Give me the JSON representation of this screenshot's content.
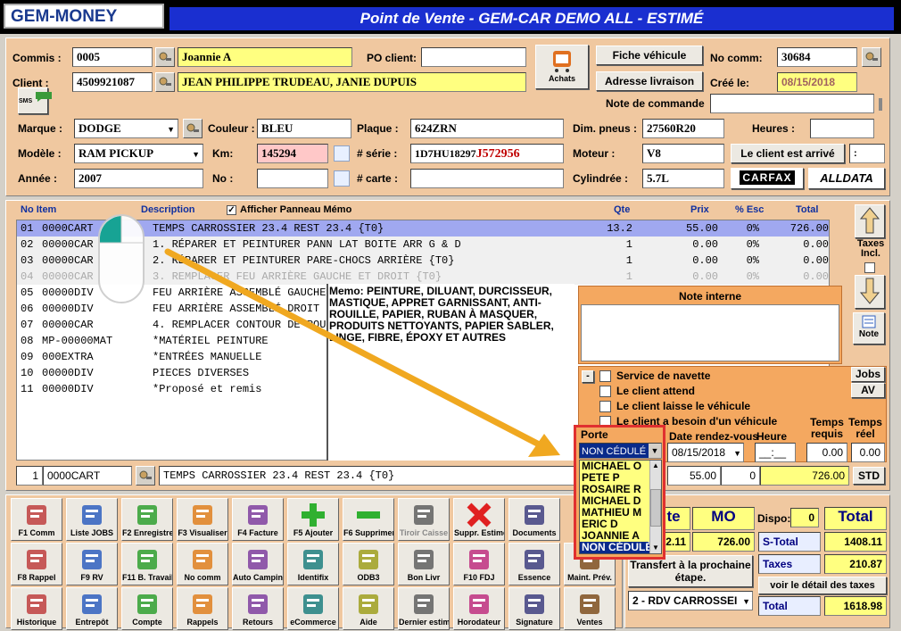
{
  "window": {
    "logo": "GEM-MONEY",
    "title": "Point de Vente - GEM-CAR DEMO ALL  - ESTIMÉ"
  },
  "header": {
    "commis_label": "Commis :",
    "commis_code": "0005",
    "commis_name": "Joannie A",
    "client_label": "Client :",
    "client_code": "4509921087",
    "client_name": "JEAN PHILIPPE TRUDEAU, JANIE DUPUIS",
    "po_label": "PO client:",
    "po_value": "",
    "achats": "Achats",
    "sms": "SMS",
    "fiche_btn": "Fiche véhicule",
    "adresse_btn": "Adresse livraison",
    "nocomm_label": "No comm:",
    "nocomm_value": "30684",
    "cree_label": "Créé le:",
    "cree_value": "08/15/2018",
    "note_cmd_label": "Note de commande",
    "note_cmd_value": ""
  },
  "vehicle": {
    "marque_label": "Marque :",
    "marque": "DODGE",
    "couleur_label": "Couleur :",
    "couleur": "BLEU",
    "plaque_label": "Plaque :",
    "plaque": "624ZRN",
    "dim_label": "Dim. pneus :",
    "dim": "27560R20",
    "heures_label": "Heures :",
    "heures": "",
    "modele_label": "Modèle :",
    "modele": "RAM PICKUP",
    "km_label": "Km:",
    "km": "145294",
    "serie_label": "# série :",
    "serie_a": "1D7HU18297",
    "serie_b": "J572956",
    "moteur_label": "Moteur :",
    "moteur": "V8",
    "arrive_btn": "Le client est arrivé",
    "arrive_val": ":",
    "annee_label": "Année :",
    "annee": "2007",
    "no_label": "No :",
    "no": "",
    "carte_label": "# carte :",
    "carte": "",
    "cyl_label": "Cylindrée :",
    "cyl": "5.7L",
    "carfax": "CARFAX",
    "alldata": "ALLDATA"
  },
  "items": {
    "h_noitem": "No Item",
    "h_desc": "Description",
    "h_memo": "Afficher Panneau Mémo",
    "h_qte": "Qte",
    "h_prix": "Prix",
    "h_esc": "% Esc",
    "h_total": "Total",
    "rows": [
      {
        "n": "01",
        "code": "0000CART",
        "desc": "TEMPS CARROSSIER 23.4  REST 23.4   {T0}",
        "qte": "13.2",
        "prix": "55.00",
        "esc": "0%",
        "total": "726.00"
      },
      {
        "n": "02",
        "code": "00000CAR",
        "desc": "1. RÉPARER ET PEINTURER PANN LAT BOITE ARR G & D",
        "qte": "1",
        "prix": "0.00",
        "esc": "0%",
        "total": "0.00"
      },
      {
        "n": "03",
        "code": "00000CAR",
        "desc": "2. RÉPARER ET PEINTURER PARE-CHOCS ARRIÈRE {T0}",
        "qte": "1",
        "prix": "0.00",
        "esc": "0%",
        "total": "0.00"
      },
      {
        "n": "04",
        "code": "00000CAR",
        "desc": "3. REMPLACER FEU ARRIÈRE GAUCHE ET DROIT {T0}",
        "qte": "1",
        "prix": "0.00",
        "esc": "0%",
        "total": "0.00"
      },
      {
        "n": "05",
        "code": "00000DIV",
        "desc": "FEU ARRIÈRE ASSEMBLÉ GAUCHE"
      },
      {
        "n": "06",
        "code": "00000DIV",
        "desc": "FEU ARRIÈRE ASSEMBLÉ DROIT"
      },
      {
        "n": "07",
        "code": "00000CAR",
        "desc": "4. REMPLACER CONTOUR DE ROUE"
      },
      {
        "n": "08",
        "code": "MP-00000MAT",
        "desc": "*MATÉRIEL PEINTURE"
      },
      {
        "n": "09",
        "code": "000EXTRA",
        "desc": "*ENTRÉES MANUELLE"
      },
      {
        "n": "10",
        "code": "00000DIV",
        "desc": "PIECES DIVERSES"
      },
      {
        "n": "11",
        "code": "00000DIV",
        "desc": "*Proposé et remis"
      }
    ],
    "memo": "Memo: PEINTURE, DILUANT, DURCISSEUR, MASTIQUE, APPRET GARNISSANT, ANTI-ROUILLE, PAPIER, RUBAN À MASQUER, PRODUITS NETTOYANTS, PAPIER SABLER, LINGE, FIBRE, ÉPOXY ET AUTRES",
    "taxes_incl": "Taxes Incl.",
    "note_btn": "Note"
  },
  "note_interne": {
    "title": "Note interne"
  },
  "options": {
    "minus": "-",
    "navette": "Service de navette",
    "attend": "Le client attend",
    "laisse": "Le client laisse le véhicule",
    "besoin": "Le client a besoin d'un véhicule",
    "jobs": "Jobs",
    "av": "AV",
    "porte_label": "Porte",
    "porte_value": "NON CÉDULÉ",
    "date_label": "Date rendez-vous",
    "date_value": "08/15/2018",
    "heure_label": "Heure",
    "heure_value": "__:__",
    "treq_label": "Temps requis",
    "treq_value": "0.00",
    "treel_label": "Temps réel",
    "treel_value": "0.00"
  },
  "dropdown": {
    "options": [
      "MICHAEL O",
      "PETE P",
      "ROSAIRE R",
      "MICHAEL D",
      "MATHIEU M",
      "ERIC D",
      "JOANNIE A",
      "NON CÉDULÉ"
    ]
  },
  "entry": {
    "n": "1",
    "code": "0000CART",
    "desc": "TEMPS CARROSSIER 23.4  REST 23.4   {T0}",
    "prix": "55.00",
    "esc": "0",
    "total": "726.00",
    "std": "STD"
  },
  "totals": {
    "h1": "te",
    "h2": "MO",
    "dispo_label": "Dispo:",
    "dispo": "0",
    "h_total": "Total",
    "v1": "2.11",
    "v2": "726.00",
    "stotal_label": "S-Total",
    "stotal": "1408.11",
    "taxes_label": "Taxes",
    "taxes": "210.87",
    "transfert": "Transfert à la prochaine étape.",
    "detail_btn": "voir le détail des taxes",
    "rdv": "2 - RDV CARROSSEI",
    "total_label": "Total",
    "total": "1618.98"
  },
  "toolbar": [
    [
      "F1 Comm",
      "Liste JOBS",
      "F2 Enregistrer",
      "F3 Visualiser",
      "F4 Facture",
      "F5 Ajouter",
      "F6 Supprimer",
      "Tiroir Caisse",
      "Suppr. Estimé",
      "Documents"
    ],
    [
      "F8 Rappel",
      "F9 RV",
      "F11 B. Travail",
      "No comm",
      "Auto Camping",
      "Identifix",
      "ODB3",
      "Bon Livr",
      "F10 FDJ",
      "Essence",
      "Maint. Prév."
    ],
    [
      "Historique",
      "Entrepôt",
      "Compte",
      "Rappels",
      "Retours",
      "eCommerce",
      "Aide",
      "Dernier estimé",
      "Horodateur",
      "Signature",
      "Ventes"
    ]
  ]
}
